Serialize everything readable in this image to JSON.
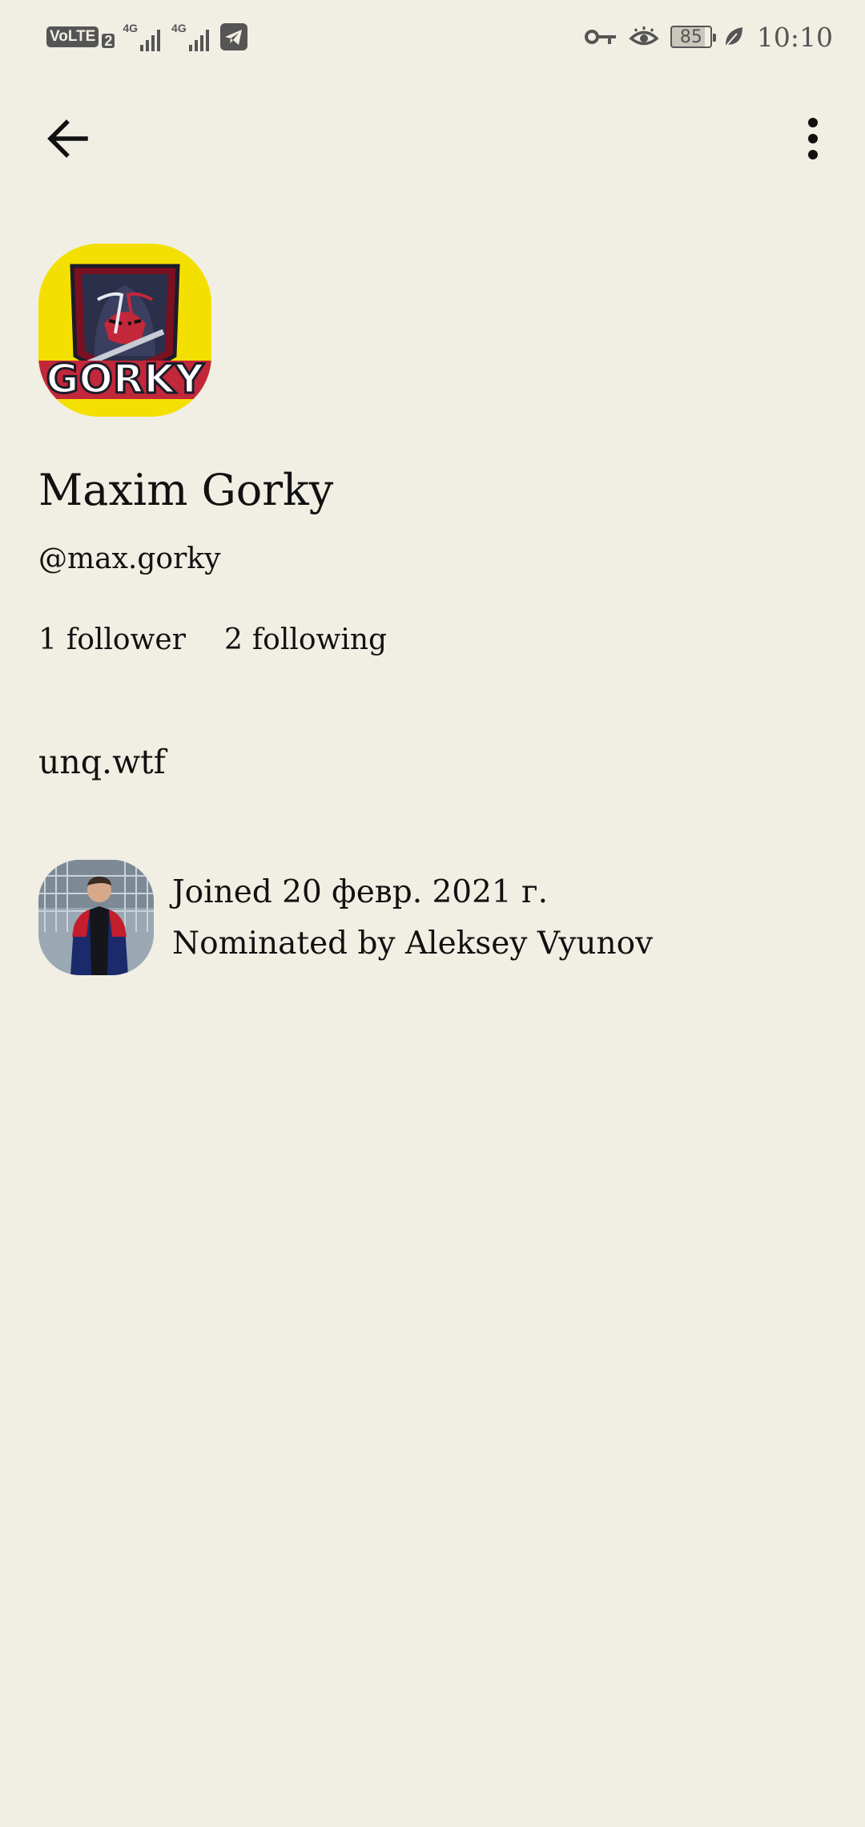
{
  "status_bar": {
    "volte": "VoLTE",
    "sim_slot": "2",
    "network_1": "4G",
    "network_2": "4G",
    "battery_level": "85",
    "time": "10:10",
    "icons": [
      "volte-icon",
      "signal-icon",
      "signal-icon",
      "telegram-icon",
      "vpn-key-icon",
      "eye-comfort-icon",
      "battery-icon",
      "leaf-icon"
    ]
  },
  "toolbar": {
    "back_icon": "arrow-left-icon",
    "more_icon": "more-vertical-icon"
  },
  "profile": {
    "avatar_text": "GORKY",
    "name": "Maxim Gorky",
    "handle": "@max.gorky",
    "followers_count": "1",
    "followers_label": "follower",
    "following_count": "2",
    "following_label": "following",
    "bio": "unq.wtf"
  },
  "membership": {
    "joined": "Joined 20 февр. 2021 г.",
    "nominated_by": "Nominated by Aleksey Vyunov"
  },
  "colors": {
    "background": "#f1eee4",
    "text": "#111111",
    "status_icons": "#555555",
    "avatar_yellow": "#f4e000"
  }
}
